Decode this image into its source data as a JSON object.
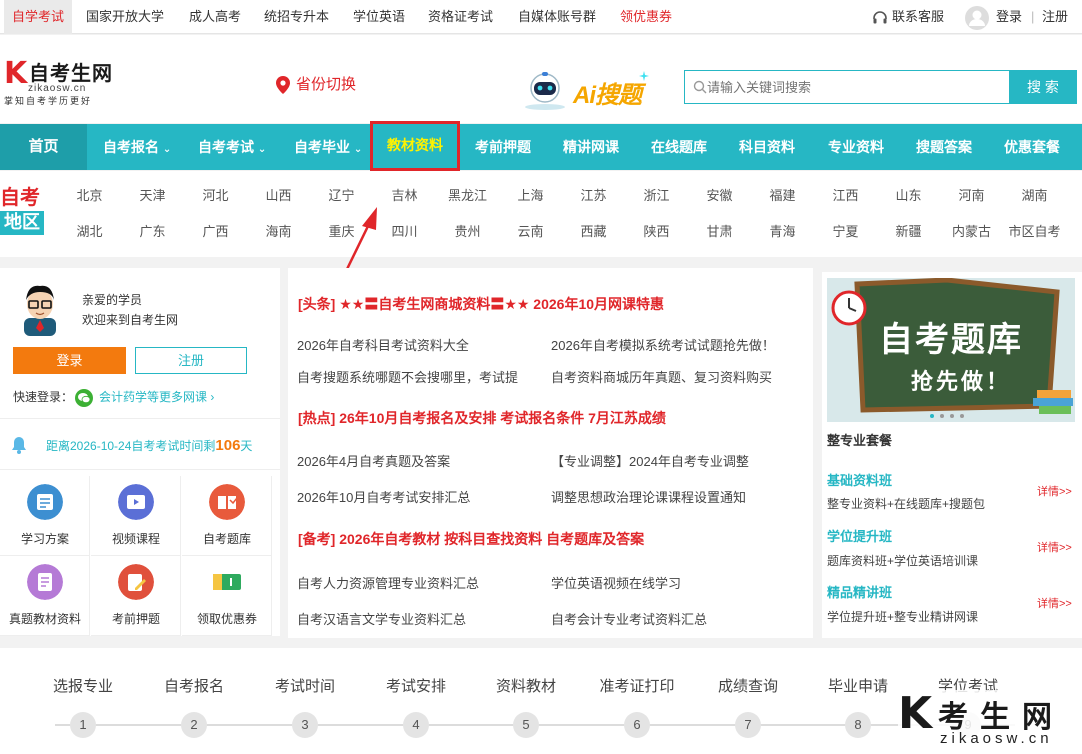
{
  "topbar": {
    "links": [
      "自学考试",
      "国家开放大学",
      "成人高考",
      "统招专升本",
      "学位英语",
      "资格证考试",
      "自媒体账号群",
      "领优惠券"
    ],
    "service": "联系客服",
    "login": "登录",
    "sep": "|",
    "register": "注册"
  },
  "logo": {
    "k": "K",
    "cn": "自考生网",
    "en": "zikaosw.cn",
    "slogan": "掌知自考学历更好"
  },
  "province": "省份切换",
  "ai": {
    "label": "Ai搜题"
  },
  "search": {
    "placeholder": "请输入关键词搜索",
    "button": "搜 索"
  },
  "nav": {
    "home": "首页",
    "items": [
      "自考报名",
      "自考考试",
      "自考毕业",
      "教材资料",
      "考前押题",
      "精讲网课",
      "在线题库",
      "科目资料",
      "专业资料",
      "搜题答案",
      "优惠套餐"
    ]
  },
  "region": {
    "tag_a": "自考",
    "tag_b": "地区",
    "row1": [
      "北京",
      "天津",
      "河北",
      "山西",
      "辽宁",
      "吉林",
      "黑龙江",
      "上海",
      "江苏",
      "浙江",
      "安徽",
      "福建",
      "江西",
      "山东",
      "河南",
      "湖南"
    ],
    "row2": [
      "湖北",
      "广东",
      "广西",
      "海南",
      "重庆",
      "四川",
      "贵州",
      "云南",
      "西藏",
      "陕西",
      "甘肃",
      "青海",
      "宁夏",
      "新疆",
      "内蒙古",
      "市区自考"
    ]
  },
  "left": {
    "greet1": "亲爱的学员",
    "greet2": "欢迎来到自考生网",
    "login": "登录",
    "register": "注册",
    "quick": "快速登录：",
    "quick_more": "会计药学等更多网课",
    "count_text": "距离2026-10-24自考考试时间剩",
    "count_num": "106",
    "count_unit": "天",
    "grid": [
      "学习方案",
      "视频课程",
      "自考题库",
      "真题教材资料",
      "考前押题",
      "领取优惠券"
    ]
  },
  "mid": {
    "h1": "[头条]  ★★〓自考生网商城资料〓★★   2026年10月网课特惠",
    "l1": [
      "2026年自考科目考试资料大全",
      "2026年自考模拟系统考试试题抢先做！",
      "自考搜题系统哪题不会搜哪里，考试提",
      "自考资料商城历年真题、复习资料购买"
    ],
    "h2": "[热点]  26年10月自考报名及安排   考试报名条件   7月江苏成绩",
    "l2": [
      "2026年4月自考真题及答案",
      "【专业调整】2024年自考专业调整",
      "2026年10月自考考试安排汇总",
      "调整思想政治理论课课程设置通知"
    ],
    "h3": "[备考]  2026年自考教材   按科目查找资料   自考题库及答案",
    "l3": [
      "自考人力资源管理专业资料汇总",
      "学位英语视频在线学习",
      "自考汉语言文学专业资料汇总",
      "自考会计专业考试资料汇总"
    ]
  },
  "right": {
    "banner_title": "自考题库",
    "banner_sub": "抢先做！",
    "title": "整专业套餐",
    "items": [
      {
        "name": "基础资料班",
        "desc": "整专业资料+在线题库+搜题包",
        "more": "详情>>"
      },
      {
        "name": "学位提升班",
        "desc": "题库资料班+学位英语培训课",
        "more": "详情>>"
      },
      {
        "name": "精品精讲班",
        "desc": "学位提升班+整专业精讲网课",
        "more": "详情>>"
      }
    ]
  },
  "steps": {
    "labels": [
      "选报专业",
      "自考报名",
      "考试时间",
      "考试安排",
      "资料教材",
      "准考证打印",
      "成绩查询",
      "毕业申请",
      "学位考试"
    ],
    "nums": [
      "1",
      "2",
      "3",
      "4",
      "5",
      "6",
      "7",
      "8",
      "9"
    ]
  },
  "watermark": {
    "k": "K",
    "cn": "考生网",
    "en": "zikaosw.cn"
  },
  "colors": {
    "accent": "#26b7c4",
    "red": "#e0262a",
    "orange": "#f37a0e",
    "highlight": "#fff200"
  }
}
